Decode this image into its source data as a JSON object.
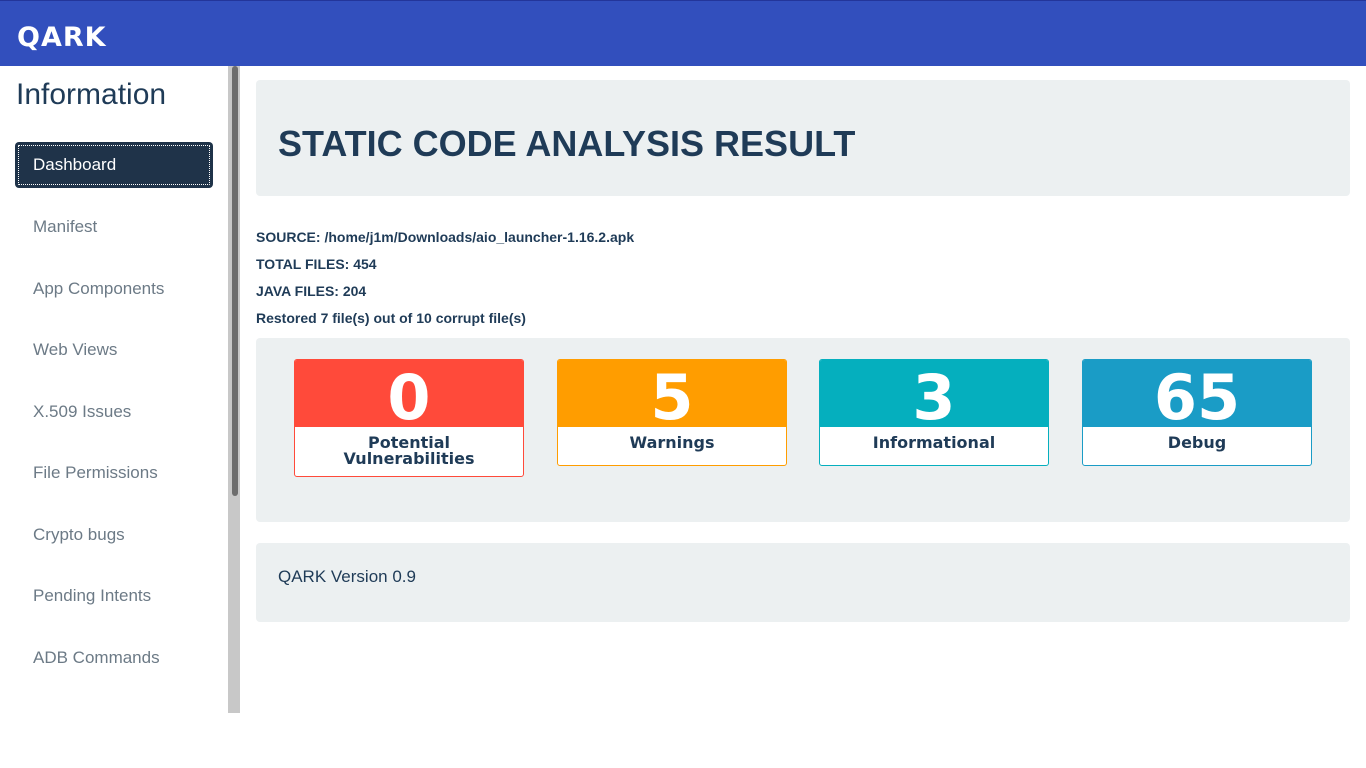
{
  "header": {
    "logo_text": "QARK",
    "bg_color": "#324fbd"
  },
  "sidebar": {
    "title": "Information",
    "items": [
      {
        "label": "Dashboard",
        "active": true
      },
      {
        "label": "Manifest"
      },
      {
        "label": "App Components"
      },
      {
        "label": "Web Views"
      },
      {
        "label": "X.509 Issues"
      },
      {
        "label": "File Permissions"
      },
      {
        "label": "Crypto bugs"
      },
      {
        "label": "Pending Intents"
      },
      {
        "label": "ADB Commands"
      }
    ]
  },
  "main": {
    "title": "STATIC CODE ANALYSIS RESULT",
    "source": "SOURCE: /home/j1m/Downloads/aio_launcher-1.16.2.apk",
    "total_files": "TOTAL FILES: 454",
    "java_files": "JAVA FILES: 204",
    "restored": "Restored 7 file(s) out of 10 corrupt file(s)",
    "stats": [
      {
        "value": "0",
        "label": "Potential Vulnerabilities",
        "color": "#ff4a3a"
      },
      {
        "value": "5",
        "label": "Warnings",
        "color": "#ff9d00"
      },
      {
        "value": "3",
        "label": "Informational",
        "color": "#05afbe"
      },
      {
        "value": "65",
        "label": "Debug",
        "color": "#1a9cc6"
      }
    ],
    "version": "QARK Version 0.9"
  }
}
